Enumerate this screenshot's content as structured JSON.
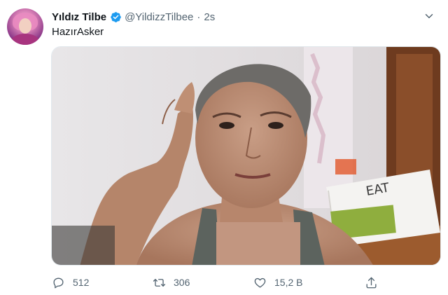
{
  "tweet": {
    "display_name": "Yıldız Tilbe",
    "handle": "@YildizzTilbee",
    "separator": "·",
    "time": "2s",
    "text": "HazırAsker",
    "verified": true
  },
  "actions": {
    "reply_count": "512",
    "retweet_count": "306",
    "like_count": "15,2 B"
  },
  "icons": {
    "verified": "verified-badge-icon",
    "more": "chevron-down-icon",
    "reply": "reply-icon",
    "retweet": "retweet-icon",
    "like": "heart-icon",
    "share": "share-icon"
  },
  "colors": {
    "verified": "#1d9bf0",
    "secondary_text": "#536471",
    "primary_text": "#0f1419"
  }
}
